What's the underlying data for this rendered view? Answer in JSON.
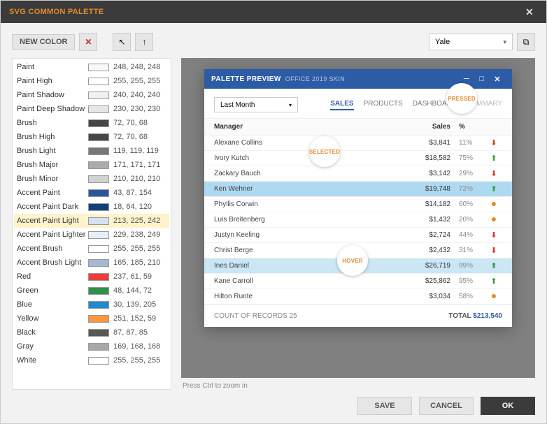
{
  "title": "SVG COMMON PALETTE",
  "toolbar": {
    "new_color": "NEW COLOR",
    "theme_dd": "Yale"
  },
  "palette": [
    {
      "name": "Paint",
      "rgb": "248, 248, 248",
      "hex": "#f8f8f8"
    },
    {
      "name": "Paint High",
      "rgb": "255, 255, 255",
      "hex": "#ffffff"
    },
    {
      "name": "Paint Shadow",
      "rgb": "240, 240, 240",
      "hex": "#f0f0f0"
    },
    {
      "name": "Paint Deep Shadow",
      "rgb": "230, 230, 230",
      "hex": "#e6e6e6"
    },
    {
      "name": "Brush",
      "rgb": "72, 70, 68",
      "hex": "#484644"
    },
    {
      "name": "Brush High",
      "rgb": "72, 70, 68",
      "hex": "#484644"
    },
    {
      "name": "Brush Light",
      "rgb": "119, 119, 119",
      "hex": "#777777"
    },
    {
      "name": "Brush Major",
      "rgb": "171, 171, 171",
      "hex": "#ababab"
    },
    {
      "name": "Brush Minor",
      "rgb": "210, 210, 210",
      "hex": "#d2d2d2"
    },
    {
      "name": "Accent Paint",
      "rgb": "43, 87, 154",
      "hex": "#2b579a"
    },
    {
      "name": "Accent Paint Dark",
      "rgb": "18, 64, 120",
      "hex": "#124078"
    },
    {
      "name": "Accent Paint Light",
      "rgb": "213, 225, 242",
      "hex": "#d5e1f2",
      "selected": true
    },
    {
      "name": "Accent Paint Lighter",
      "rgb": "229, 238, 249",
      "hex": "#e5eef9"
    },
    {
      "name": "Accent Brush",
      "rgb": "255, 255, 255",
      "hex": "#ffffff"
    },
    {
      "name": "Accent Brush Light",
      "rgb": "165, 185, 210",
      "hex": "#a5b9d2"
    },
    {
      "name": "Red",
      "rgb": "237, 61, 59",
      "hex": "#ed3d3b"
    },
    {
      "name": "Green",
      "rgb": "48, 144, 72",
      "hex": "#309048"
    },
    {
      "name": "Blue",
      "rgb": "30, 139, 205",
      "hex": "#1e8bcd"
    },
    {
      "name": "Yellow",
      "rgb": "251, 152, 59",
      "hex": "#fb983b"
    },
    {
      "name": "Black",
      "rgb": "87, 87, 85",
      "hex": "#575755"
    },
    {
      "name": "Gray",
      "rgb": "169, 168, 168",
      "hex": "#a9a8a8"
    },
    {
      "name": "White",
      "rgb": "255, 255, 255",
      "hex": "#ffffff"
    }
  ],
  "preview": {
    "title": "PALETTE PREVIEW",
    "subtitle": "OFFICE 2019 SKIN",
    "period": "Last Month",
    "tabs": [
      "SALES",
      "PRODUCTS",
      "DASHBOARD",
      "SUMMARY"
    ],
    "active_tab": "SALES",
    "badges": {
      "pressed": "PRESSED",
      "selected": "SELECTED",
      "hover": "HOVER"
    },
    "cols": {
      "manager": "Manager",
      "sales": "Sales",
      "pct": "%"
    },
    "rows": [
      {
        "name": "Alexane Collins",
        "sales": "$3,841",
        "pct": "11%",
        "ind": "dn"
      },
      {
        "name": "Ivory Kutch",
        "sales": "$18,582",
        "pct": "75%",
        "ind": "up"
      },
      {
        "name": "Zackary Bauch",
        "sales": "$3,142",
        "pct": "29%",
        "ind": "dn"
      },
      {
        "name": "Ken Wehner",
        "sales": "$19,748",
        "pct": "72%",
        "ind": "up",
        "sel": true
      },
      {
        "name": "Phyllis Corwin",
        "sales": "$14,182",
        "pct": "60%",
        "ind": "dot"
      },
      {
        "name": "Luis Breitenberg",
        "sales": "$1,432",
        "pct": "20%",
        "ind": "dot"
      },
      {
        "name": "Justyn Keeling",
        "sales": "$2,724",
        "pct": "44%",
        "ind": "dn"
      },
      {
        "name": "Christ Berge",
        "sales": "$2,432",
        "pct": "31%",
        "ind": "dn"
      },
      {
        "name": "Ines Daniel",
        "sales": "$26,719",
        "pct": "99%",
        "ind": "up",
        "hov": true
      },
      {
        "name": "Kane Carroll",
        "sales": "$25,862",
        "pct": "95%",
        "ind": "up"
      },
      {
        "name": "Hilton Runte",
        "sales": "$3,034",
        "pct": "58%",
        "ind": "dot"
      }
    ],
    "footer": {
      "count": "COUNT OF RECORDS 25",
      "total_lbl": "TOTAL",
      "total_val": "$213,540"
    }
  },
  "hint": "Press Ctrl to zoom in",
  "buttons": {
    "save": "SAVE",
    "cancel": "CANCEL",
    "ok": "OK"
  }
}
